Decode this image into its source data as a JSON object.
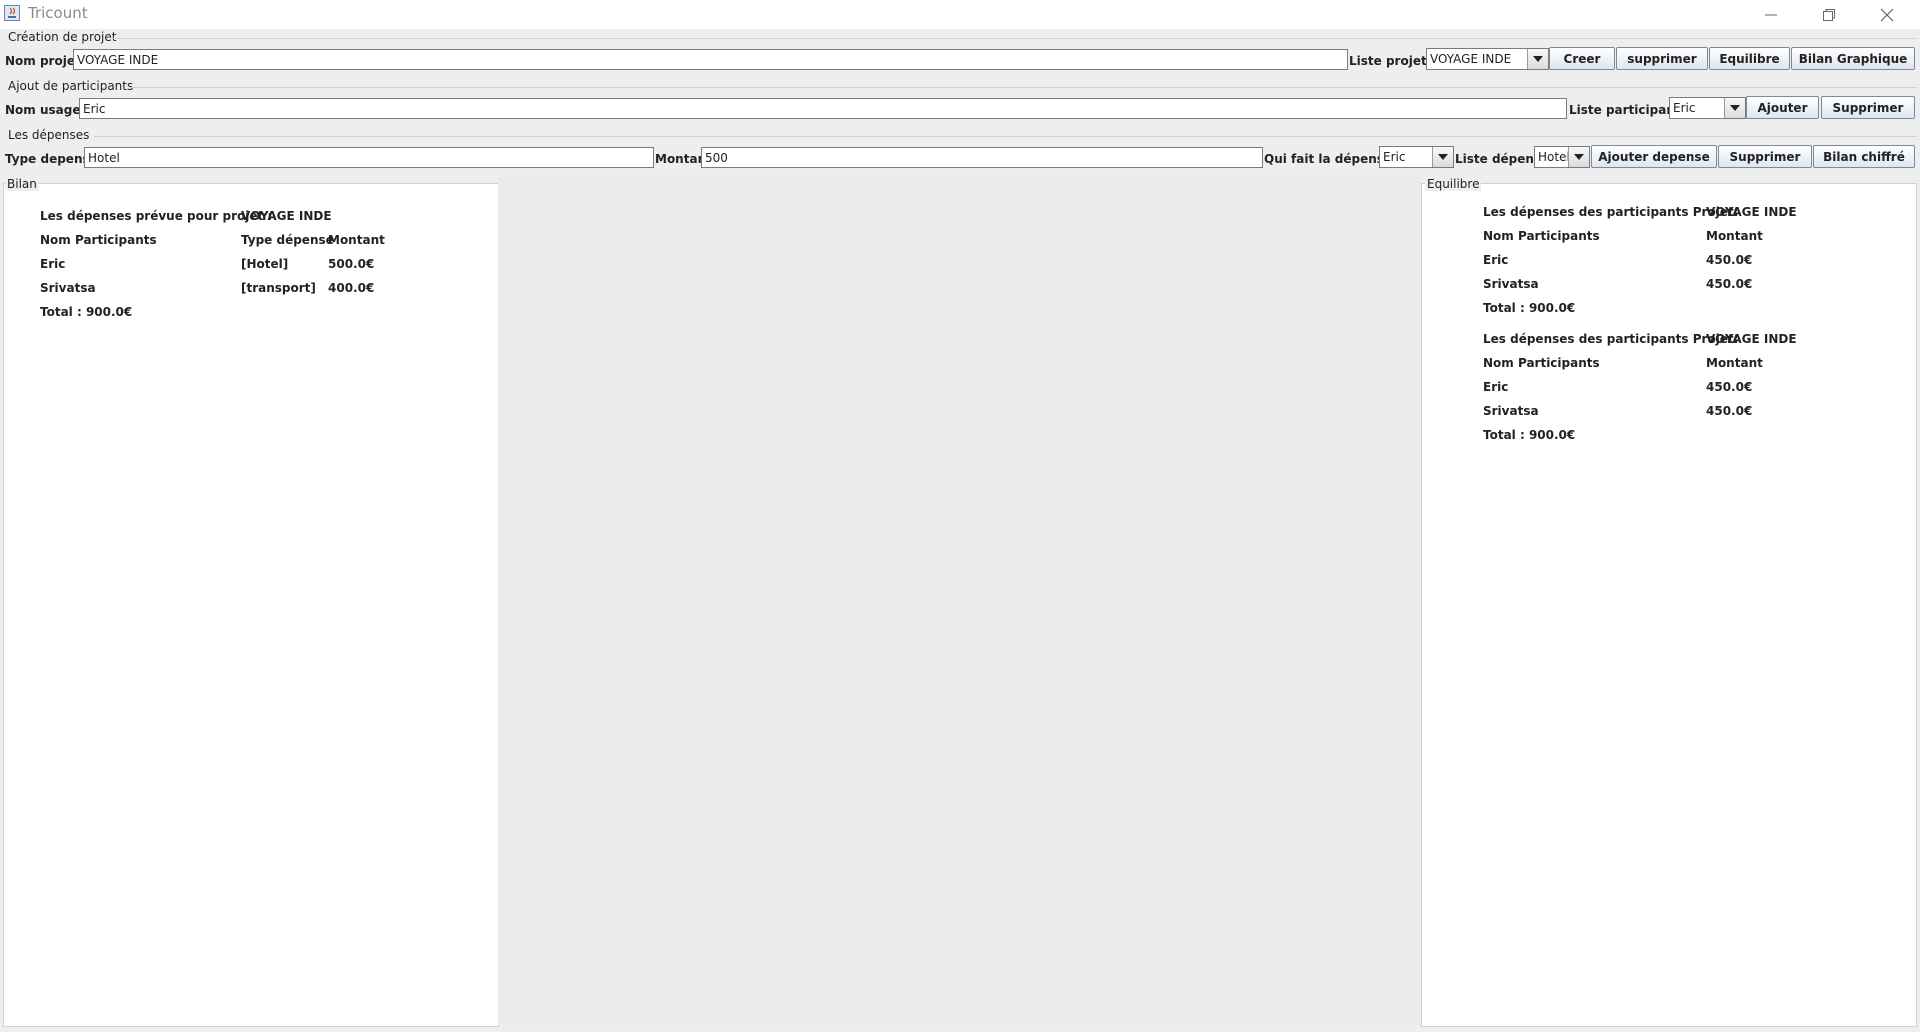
{
  "window": {
    "title": "Tricount"
  },
  "creation": {
    "section_title": "Création de projet",
    "nom_label": "Nom projet :",
    "nom_value": "VOYAGE INDE",
    "liste_label": "Liste projets :",
    "liste_selected": "VOYAGE INDE",
    "buttons": [
      "Creer",
      "supprimer",
      "Equilibre",
      "Bilan Graphique"
    ]
  },
  "participants": {
    "section_title": "Ajout de participants",
    "nom_label": "Nom usager :",
    "nom_value": "Eric",
    "liste_label": "Liste participant :",
    "liste_selected": "Eric",
    "buttons": [
      "Ajouter",
      "Supprimer"
    ]
  },
  "depenses": {
    "section_title": "Les dépenses",
    "type_label": "Type depense",
    "type_value": "Hotel",
    "montant_label": "Montant",
    "montant_value": "500",
    "qui_label": "Qui fait la dépense ?",
    "qui_selected": "Eric",
    "liste_label": "Liste dépense",
    "liste_selected": "Hotel",
    "buttons": [
      "Ajouter depense",
      "Supprimer",
      "Bilan chiffré"
    ]
  },
  "bilan": {
    "title": "Bilan",
    "heading_label": "Les dépenses prévue pour projet :",
    "heading_project": "VOYAGE INDE",
    "headers": [
      "Nom Participants",
      "Type dépense",
      "Montant"
    ],
    "rows": [
      [
        "Eric",
        "[Hotel]",
        "500.0€"
      ],
      [
        "Srivatsa",
        "[transport]",
        "400.0€"
      ]
    ],
    "total": "Total : 900.0€"
  },
  "equilibre": {
    "title": "Equilibre",
    "blocks": [
      {
        "heading_label": "Les dépenses des participants Projet:",
        "heading_project": "VOYAGE INDE",
        "headers": [
          "Nom Participants",
          "Montant"
        ],
        "rows": [
          [
            "Eric",
            "450.0€"
          ],
          [
            "Srivatsa",
            "450.0€"
          ]
        ],
        "total": "Total : 900.0€"
      },
      {
        "heading_label": "Les dépenses des participants Projet:",
        "heading_project": "VOYAGE INDE",
        "headers": [
          "Nom Participants",
          "Montant"
        ],
        "rows": [
          [
            "Eric",
            "450.0€"
          ],
          [
            "Srivatsa",
            "450.0€"
          ]
        ],
        "total": "Total : 900.0€"
      }
    ]
  }
}
